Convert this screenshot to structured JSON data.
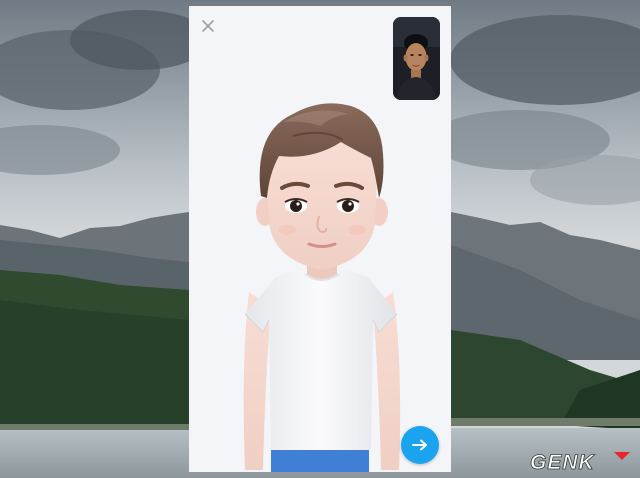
{
  "app": {
    "accent_color": "#1aa3ef"
  },
  "toolbar": {
    "close_icon": "close-icon"
  },
  "camera_preview": {
    "icon": "front-camera-preview"
  },
  "avatar": {
    "description_icon": "ar-emoji-avatar"
  },
  "actions": {
    "next_icon": "arrow-right-icon"
  },
  "watermark": {
    "text": "GENK"
  }
}
